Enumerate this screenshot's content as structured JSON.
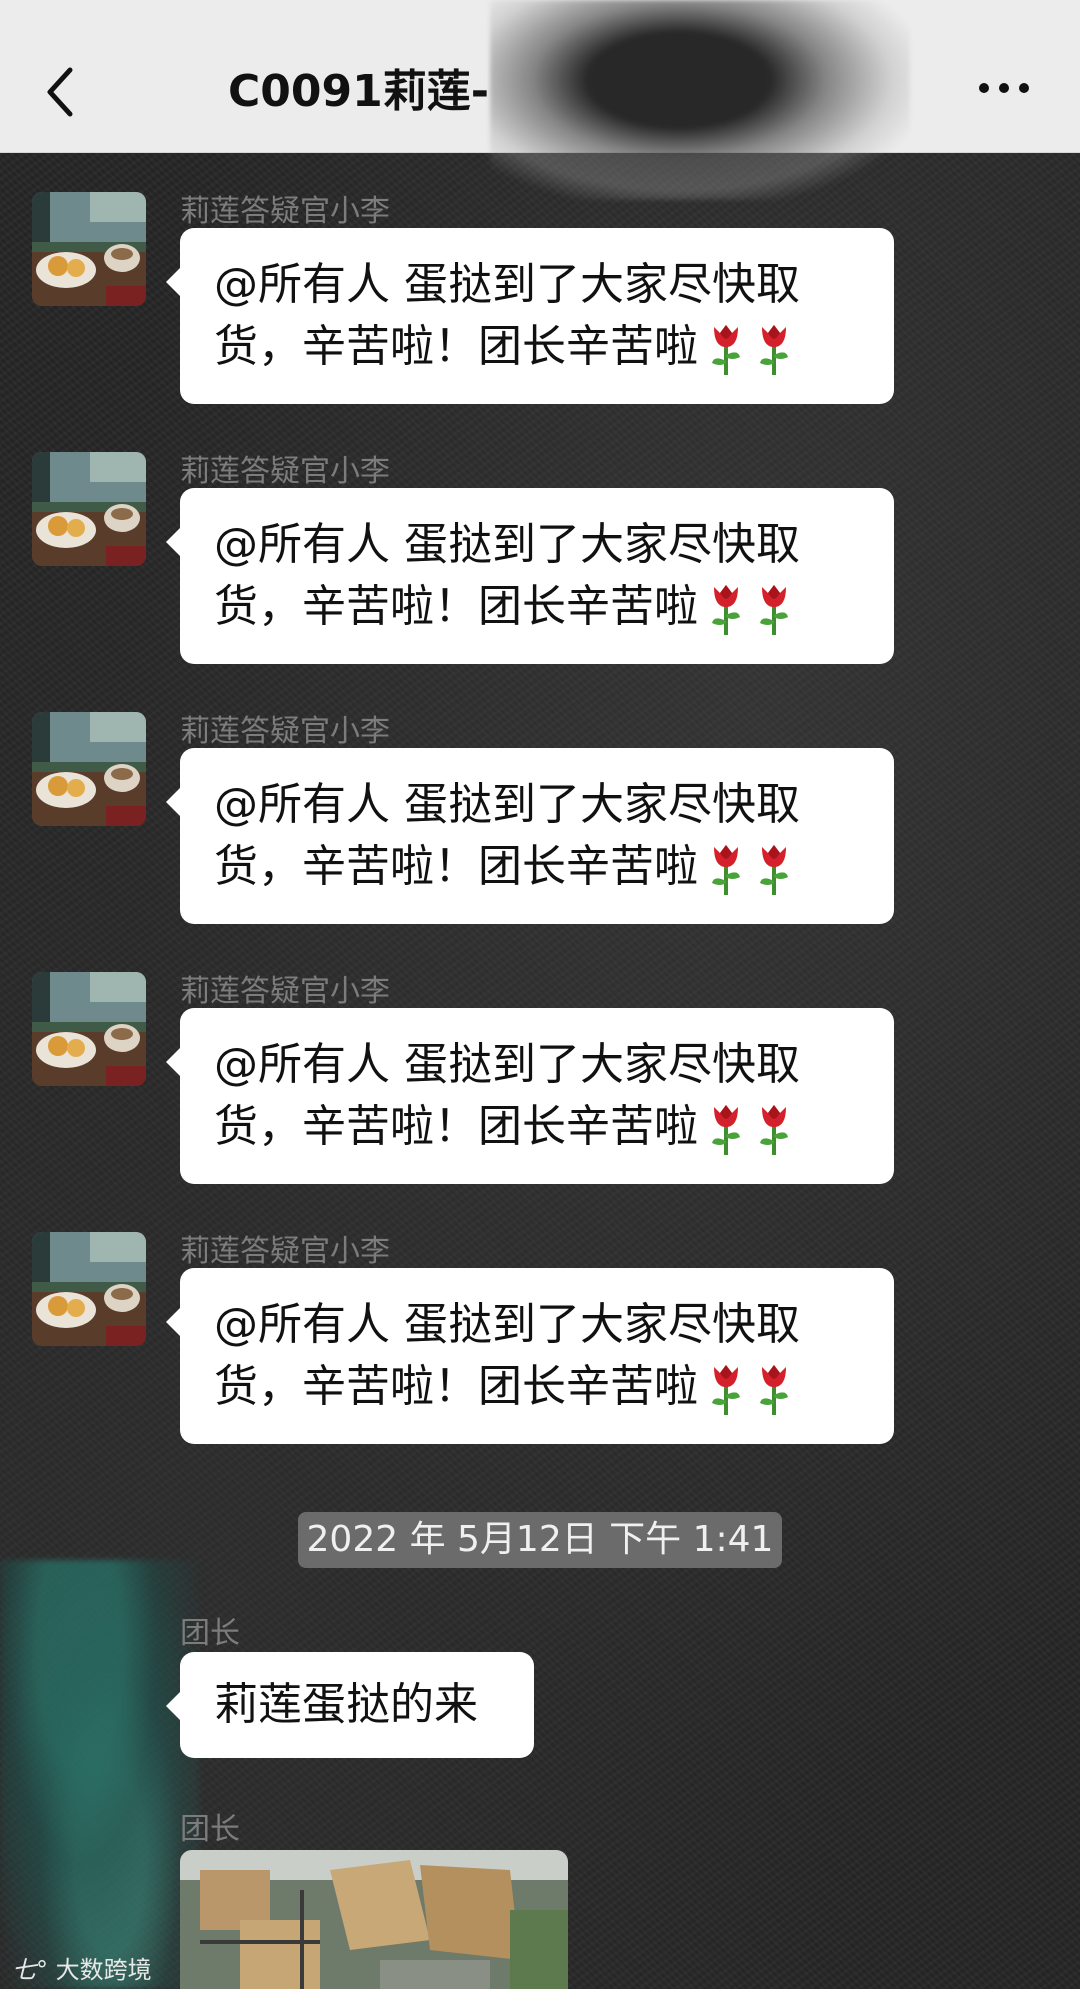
{
  "header": {
    "title": "C0091莉莲-",
    "back_icon": "chevron-left-icon",
    "more_icon": "more-dots-icon",
    "background": "#ececec"
  },
  "messages": [
    {
      "sender": "莉莲答疑官小李",
      "lines": [
        "@所有人  蛋挞到了大家尽快取",
        "货，辛苦啦！团长辛苦啦"
      ],
      "emoji": [
        "rose",
        "rose"
      ]
    },
    {
      "sender": "莉莲答疑官小李",
      "lines": [
        "@所有人  蛋挞到了大家尽快取",
        "货，辛苦啦！团长辛苦啦"
      ],
      "emoji": [
        "rose",
        "rose"
      ]
    },
    {
      "sender": "莉莲答疑官小李",
      "lines": [
        "@所有人  蛋挞到了大家尽快取",
        "货，辛苦啦！团长辛苦啦"
      ],
      "emoji": [
        "rose",
        "rose"
      ]
    },
    {
      "sender": "莉莲答疑官小李",
      "lines": [
        "@所有人  蛋挞到了大家尽快取",
        "货，辛苦啦！团长辛苦啦"
      ],
      "emoji": [
        "rose",
        "rose"
      ]
    },
    {
      "sender": "莉莲答疑官小李",
      "lines": [
        "@所有人  蛋挞到了大家尽快取",
        "货，辛苦啦！团长辛苦啦"
      ],
      "emoji": [
        "rose",
        "rose"
      ]
    }
  ],
  "timestamp": "2022 年 5月12日 下午 1:41",
  "later_messages": [
    {
      "sender": "团长",
      "text": "莉莲蛋挞的来"
    },
    {
      "sender": "团长",
      "type": "image"
    }
  ],
  "watermark": "大数跨境",
  "colors": {
    "bubble": "#ffffff",
    "sender": "#7c7c7c",
    "timestamp_bg": "#6b6b6b"
  }
}
